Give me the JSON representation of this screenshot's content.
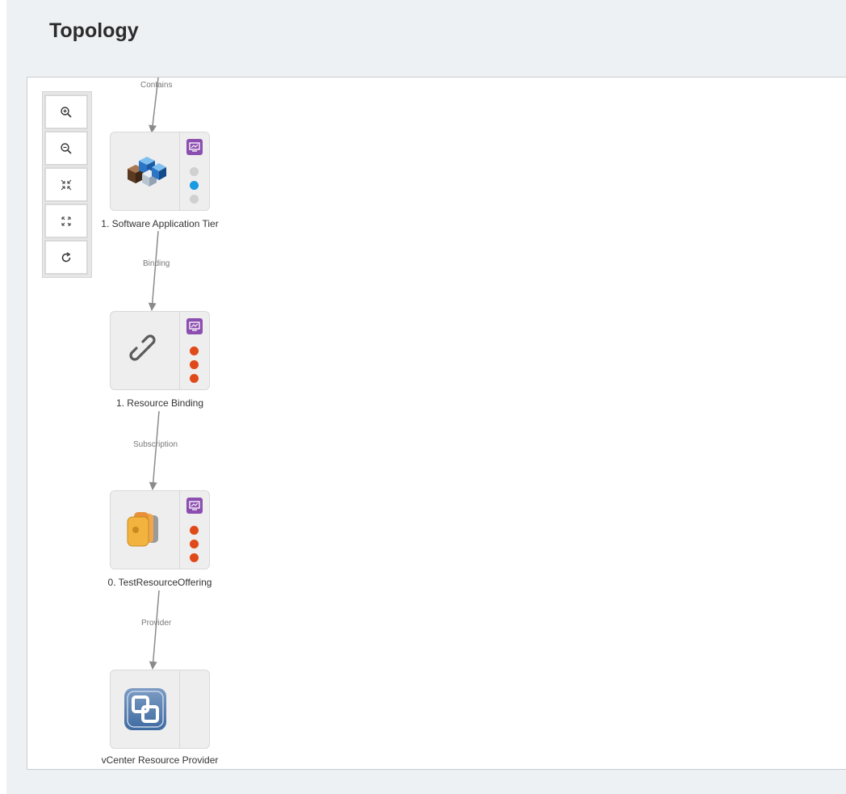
{
  "page": {
    "title": "Topology"
  },
  "toolbar": {
    "buttons": [
      {
        "name": "zoom-in-button",
        "icon": "zoom-in-icon"
      },
      {
        "name": "zoom-out-button",
        "icon": "zoom-out-icon"
      },
      {
        "name": "collapse-button",
        "icon": "collapse-icon"
      },
      {
        "name": "expand-button",
        "icon": "expand-icon"
      },
      {
        "name": "refresh-button",
        "icon": "refresh-icon"
      }
    ]
  },
  "edges": [
    {
      "label": "Contains"
    },
    {
      "label": "Binding"
    },
    {
      "label": "Subscription"
    },
    {
      "label": "Provider"
    }
  ],
  "nodes": [
    {
      "label": "1. Software Application Tier",
      "icon": "cubes-icon",
      "badge": "monitor-icon",
      "status_dots": [
        "#d0d0d0",
        "#1a9ae0",
        "#d0d0d0"
      ]
    },
    {
      "label": "1. Resource Binding",
      "icon": "chain-link-icon",
      "badge": "monitor-icon",
      "status_dots": [
        "#e04a1a",
        "#e04a1a",
        "#e04a1a"
      ]
    },
    {
      "label": "0. TestResourceOffering",
      "icon": "offering-stack-icon",
      "badge": "monitor-icon",
      "status_dots": [
        "#e04a1a",
        "#e04a1a",
        "#e04a1a"
      ]
    },
    {
      "label": "vCenter Resource Provider",
      "icon": "vcenter-icon",
      "badge": "",
      "status_dots": []
    }
  ],
  "colors": {
    "badge": "#8c4fb0",
    "edge": "#8a8a8a",
    "error": "#e04a1a",
    "ok": "#1a9ae0",
    "neutral": "#d0d0d0"
  }
}
